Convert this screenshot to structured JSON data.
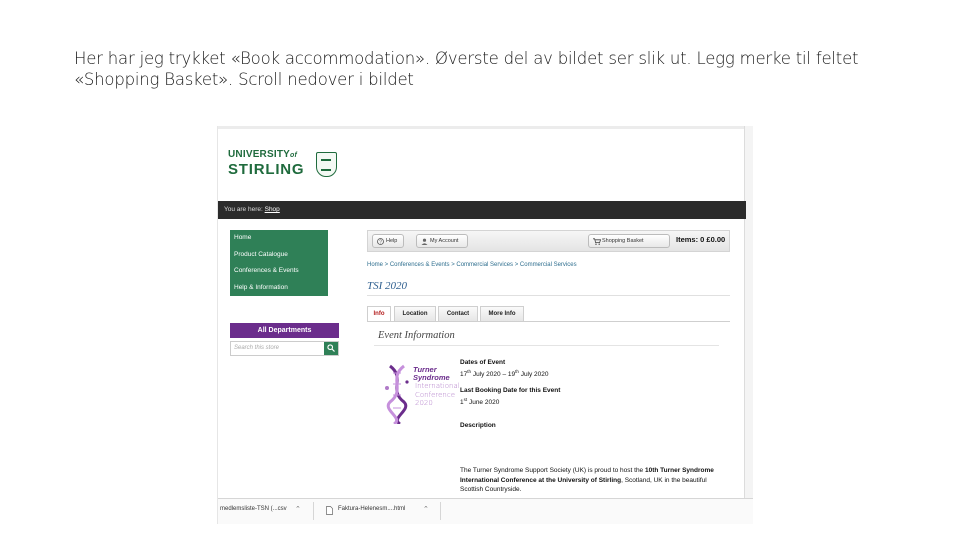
{
  "caption": {
    "line1": "Her har jeg trykket «Book accommodation». Øverste del av bildet ser slik ut. Legg merke til feltet",
    "line2": "«Shopping Basket». Scroll nedover i bildet"
  },
  "site": {
    "logo_university": "UNIVERSITY",
    "logo_of": "of",
    "logo_stirling": "STIRLING",
    "youarehere_label": "You are here:",
    "youarehere_link": "Shop"
  },
  "leftnav": {
    "items": [
      "Home",
      "Product Catalogue",
      "Conferences & Events",
      "Help & Information"
    ]
  },
  "all_departments": "All Departments",
  "search": {
    "placeholder": "Search this store"
  },
  "toolbar": {
    "help": "Help",
    "account": "My Account",
    "basket": "Shopping Basket",
    "items_summary": "Items: 0 £0.00"
  },
  "breadcrumb_trail": "Home > Conferences & Events > Commercial Services > Commercial Services",
  "page_title": "TSI 2020",
  "tabs": [
    "Info",
    "Location",
    "Contact",
    "More Info"
  ],
  "event": {
    "heading": "Event Information",
    "logo_line1": "Turner",
    "logo_line2": "Syndrome",
    "logo_line3": "International",
    "logo_line4": "Conference",
    "logo_line5": "2020",
    "dates_label": "Dates of Event",
    "date_start_day": "17",
    "date_start_sup": "th",
    "date_start_rest": "July 2020 – 19",
    "date_end_sup": "th",
    "date_end_rest": "July 2020",
    "last_booking_label": "Last Booking Date for this Event",
    "last_booking_day": "1",
    "last_booking_sup": "st",
    "last_booking_rest": "June 2020",
    "description_label": "Description",
    "desc_part1": "The Turner Syndrome Support Society (UK) is proud to host the ",
    "desc_bold1": "10th Turner Syndrome International Conference at the University of Stirling",
    "desc_part2": ", Scotland, UK in the beautiful Scottish Countryside."
  },
  "downloads": {
    "item1": "medlemsliste-TSN (...csv",
    "item2": "Faktura-Helenesm....html"
  },
  "colors": {
    "stirling_green": "#2f8057",
    "purple": "#6b2d8c",
    "active_tab": "#b31c1c"
  }
}
